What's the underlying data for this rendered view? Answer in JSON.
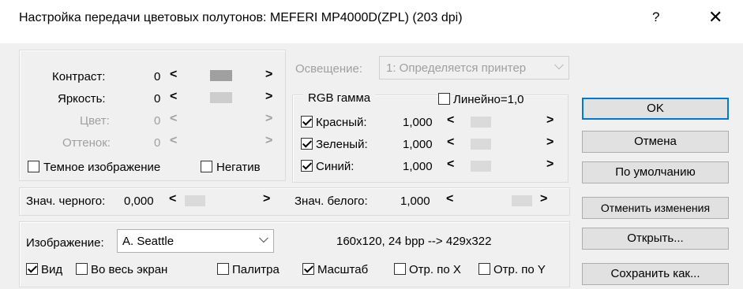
{
  "window": {
    "title": "Настройка передачи цветовых полутонов: MEFERI MP4000D(ZPL) (203 dpi)",
    "help_label": "?",
    "close_label": "✕"
  },
  "adjust": {
    "contrast": {
      "label": "Контраст:",
      "value": "0"
    },
    "brightness": {
      "label": "Яркость:",
      "value": "0"
    },
    "color": {
      "label": "Цвет:",
      "value": "0"
    },
    "hue": {
      "label": "Оттенок:",
      "value": "0"
    },
    "dark_image": {
      "label": "Темное изображение",
      "checked": false
    },
    "negative": {
      "label": "Негатив",
      "checked": false
    }
  },
  "illumination": {
    "label": "Освещение:",
    "value": "1: Определяется принтер"
  },
  "rgb_gamma": {
    "title": "RGB гамма",
    "linear": {
      "label": "Линейно=1,0",
      "checked": false
    },
    "red": {
      "label": "Красный:",
      "value": "1,000",
      "checked": true
    },
    "green": {
      "label": "Зеленый:",
      "value": "1,000",
      "checked": true
    },
    "blue": {
      "label": "Синий:",
      "value": "1,000",
      "checked": true
    }
  },
  "levels": {
    "black": {
      "label": "Знач. черного:",
      "value": "0,000"
    },
    "white": {
      "label": "Знач. белого:",
      "value": "1,000"
    }
  },
  "image": {
    "label": "Изображение:",
    "selected": "A. Seattle",
    "info": "160x120, 24 bpp  --> 429x322",
    "view": {
      "label": "Вид",
      "checked": true
    },
    "fullscreen": {
      "label": "Во весь экран",
      "checked": false
    },
    "palette": {
      "label": "Палитра",
      "checked": false
    },
    "scale": {
      "label": "Масштаб",
      "checked": true
    },
    "flip_x": {
      "label": "Отр. по X",
      "checked": false
    },
    "flip_y": {
      "label": "Отр. по Y",
      "checked": false
    }
  },
  "buttons": {
    "ok": "OK",
    "cancel": "Отмена",
    "default": "По умолчанию",
    "undo": "Отменить изменения",
    "open": "Открыть...",
    "save_as": "Сохранить как..."
  },
  "glyphs": {
    "left": "<",
    "right": ">",
    "chevron": "⌵"
  },
  "colors": {
    "accent": "#0078d7",
    "dialog_bg": "#f0f0f0",
    "disabled_text": "#a0a0a0"
  }
}
